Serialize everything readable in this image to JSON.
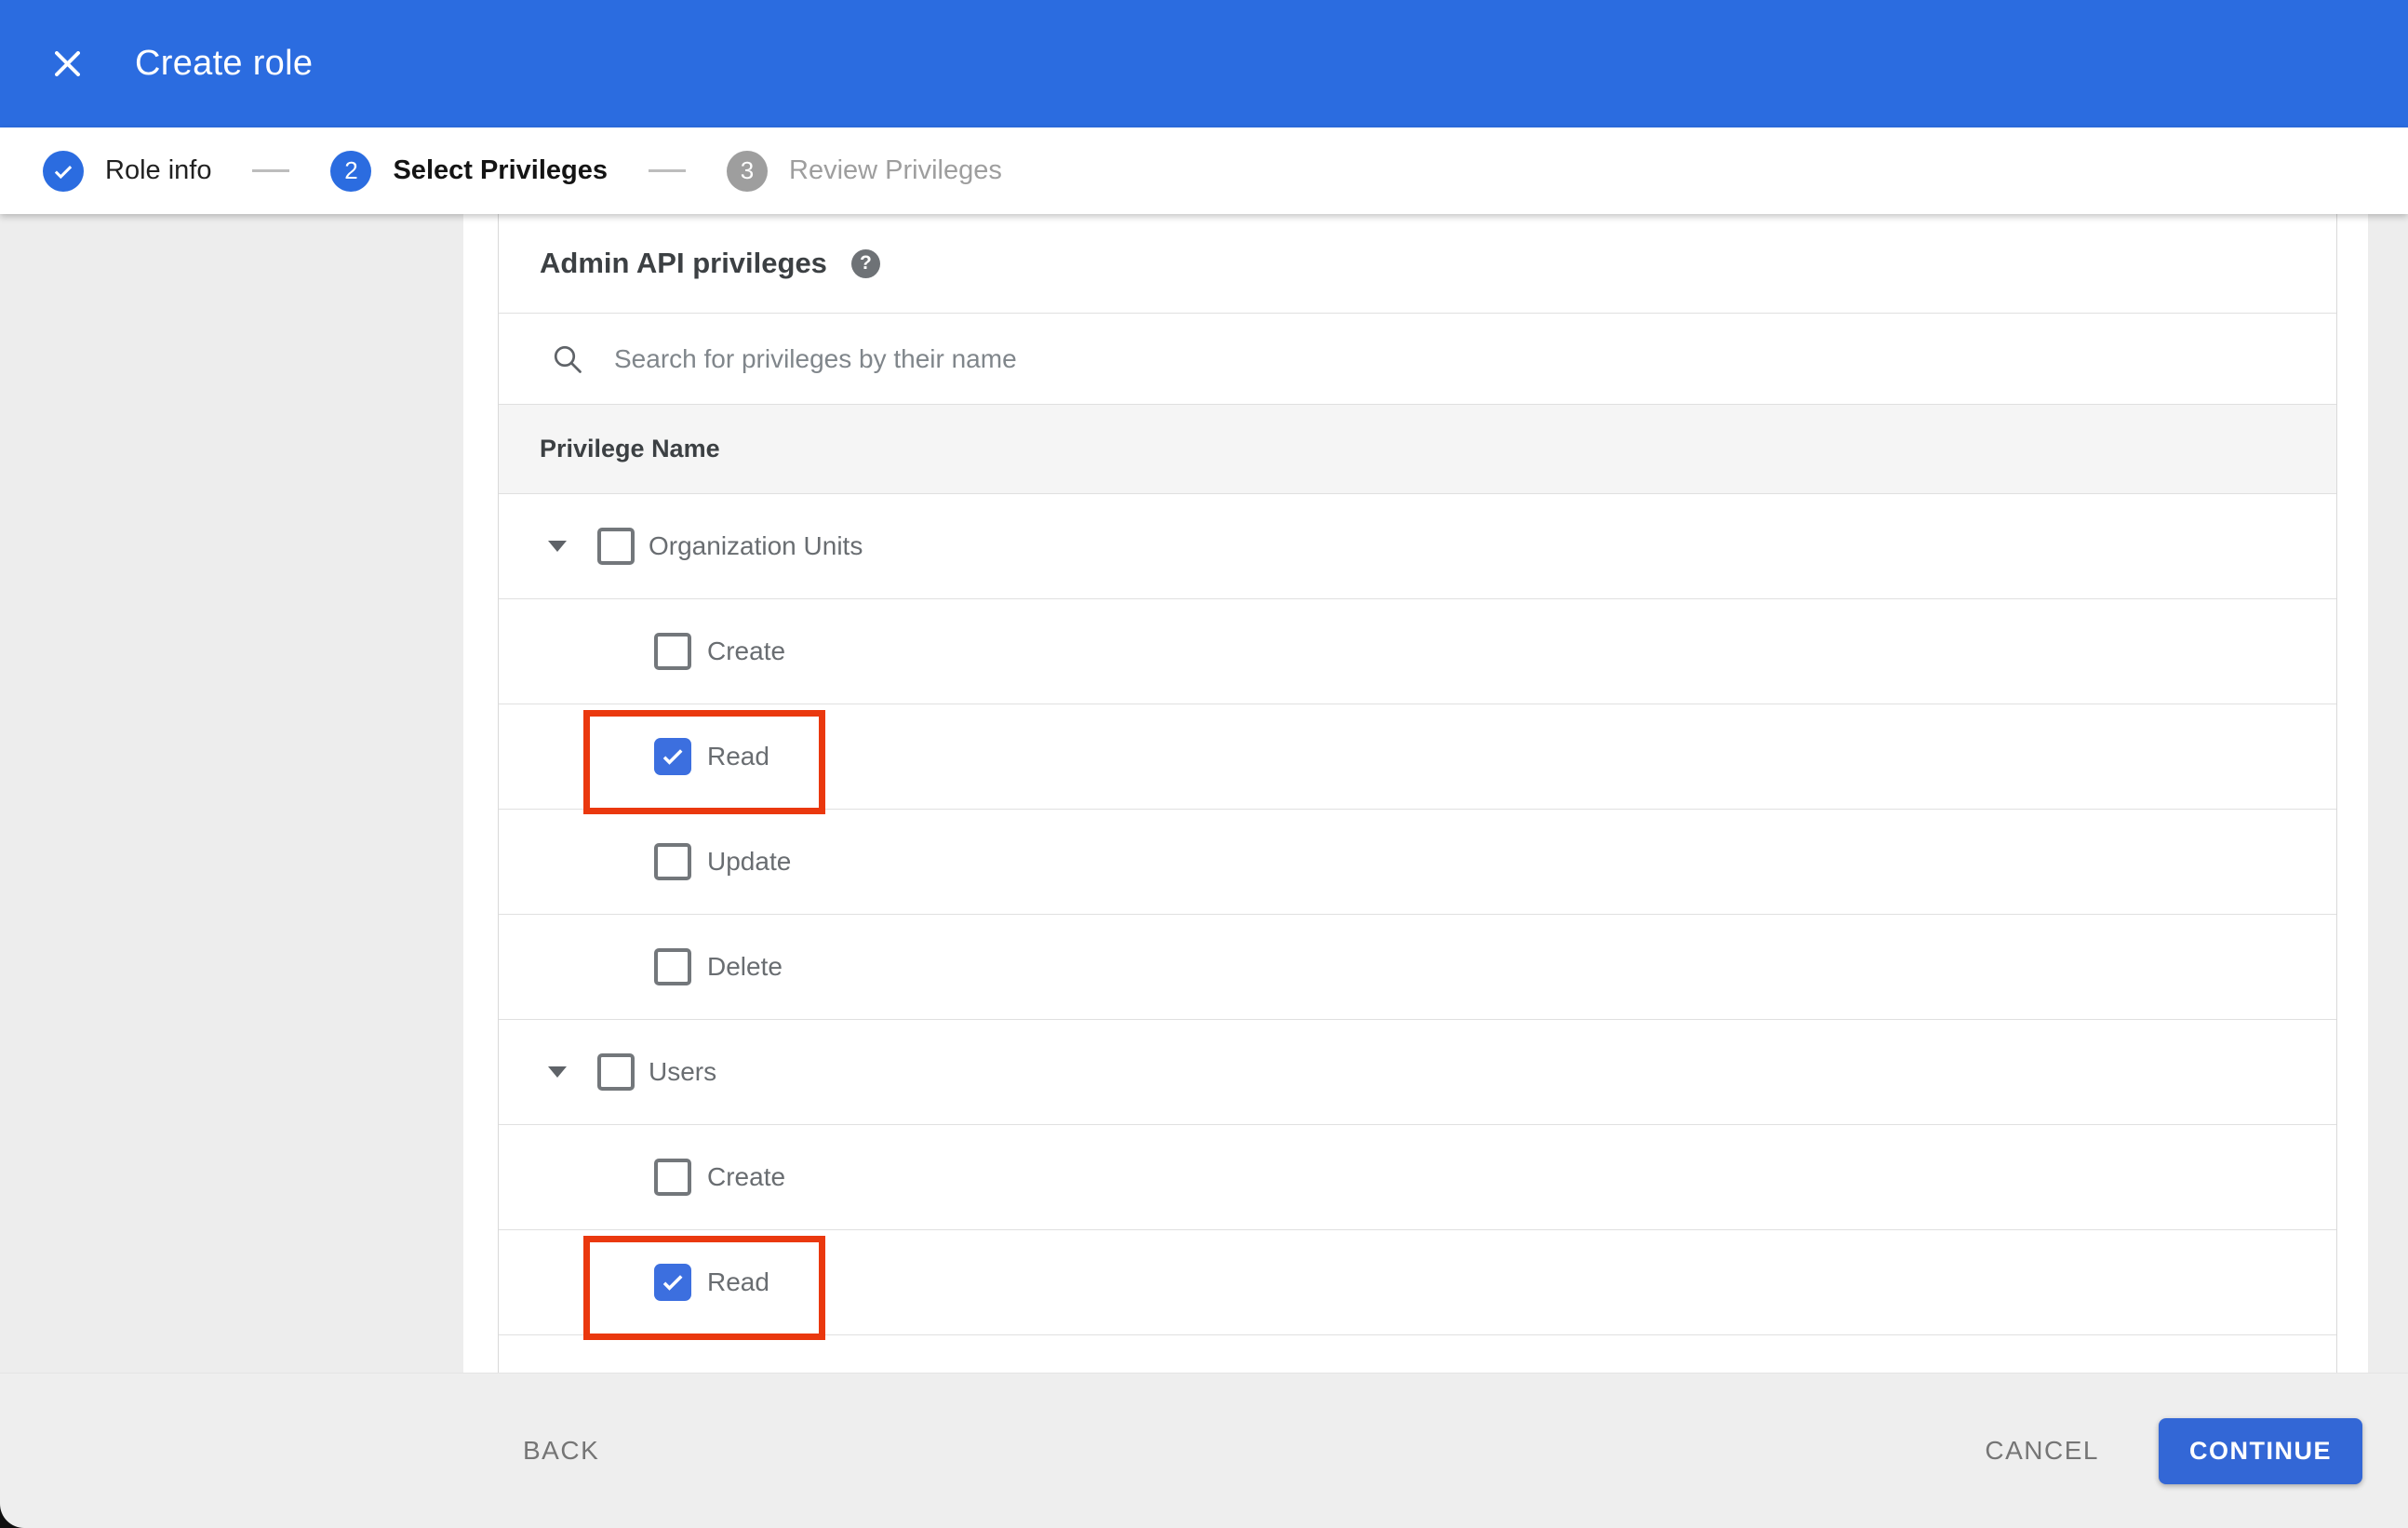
{
  "app_bar": {
    "title": "Create role",
    "close_icon": "x-icon",
    "background_color": "#2b6ce0"
  },
  "stepper": {
    "steps": [
      {
        "label": "Role info",
        "state": "completed",
        "icon": "check-icon"
      },
      {
        "number": "2",
        "label": "Select Privileges",
        "state": "active"
      },
      {
        "number": "3",
        "label": "Review Privileges",
        "state": "upcoming"
      }
    ]
  },
  "panel": {
    "title": "Admin API privileges",
    "help_icon": "help-icon",
    "search": {
      "icon": "search-icon",
      "placeholder": "Search for privileges by their name",
      "value": ""
    },
    "table": {
      "header": "Privilege Name",
      "rows": [
        {
          "label": "Organization Units",
          "type": "group",
          "checked": false,
          "expanded": true,
          "highlighted": false
        },
        {
          "label": "Create",
          "type": "child",
          "checked": false,
          "highlighted": false
        },
        {
          "label": "Read",
          "type": "child",
          "checked": true,
          "highlighted": true
        },
        {
          "label": "Update",
          "type": "child",
          "checked": false,
          "highlighted": false
        },
        {
          "label": "Delete",
          "type": "child",
          "checked": false,
          "highlighted": false
        },
        {
          "label": "Users",
          "type": "group",
          "checked": false,
          "expanded": true,
          "highlighted": false
        },
        {
          "label": "Create",
          "type": "child",
          "checked": false,
          "highlighted": false
        },
        {
          "label": "Read",
          "type": "child",
          "checked": true,
          "highlighted": true
        }
      ]
    }
  },
  "footer": {
    "back_label": "BACK",
    "cancel_label": "CANCEL",
    "continue_label": "CONTINUE"
  },
  "colors": {
    "app_bar_blue": "#2b6ce0",
    "checkbox_blue": "#3c6fdf",
    "continue_blue": "#3367d6",
    "highlight_red": "#ea380e",
    "panel_gray": "#ededed",
    "footer_gray": "#eeeeee",
    "table_header_gray": "#f5f5f5",
    "divider_gray": "#e0e0e0"
  }
}
